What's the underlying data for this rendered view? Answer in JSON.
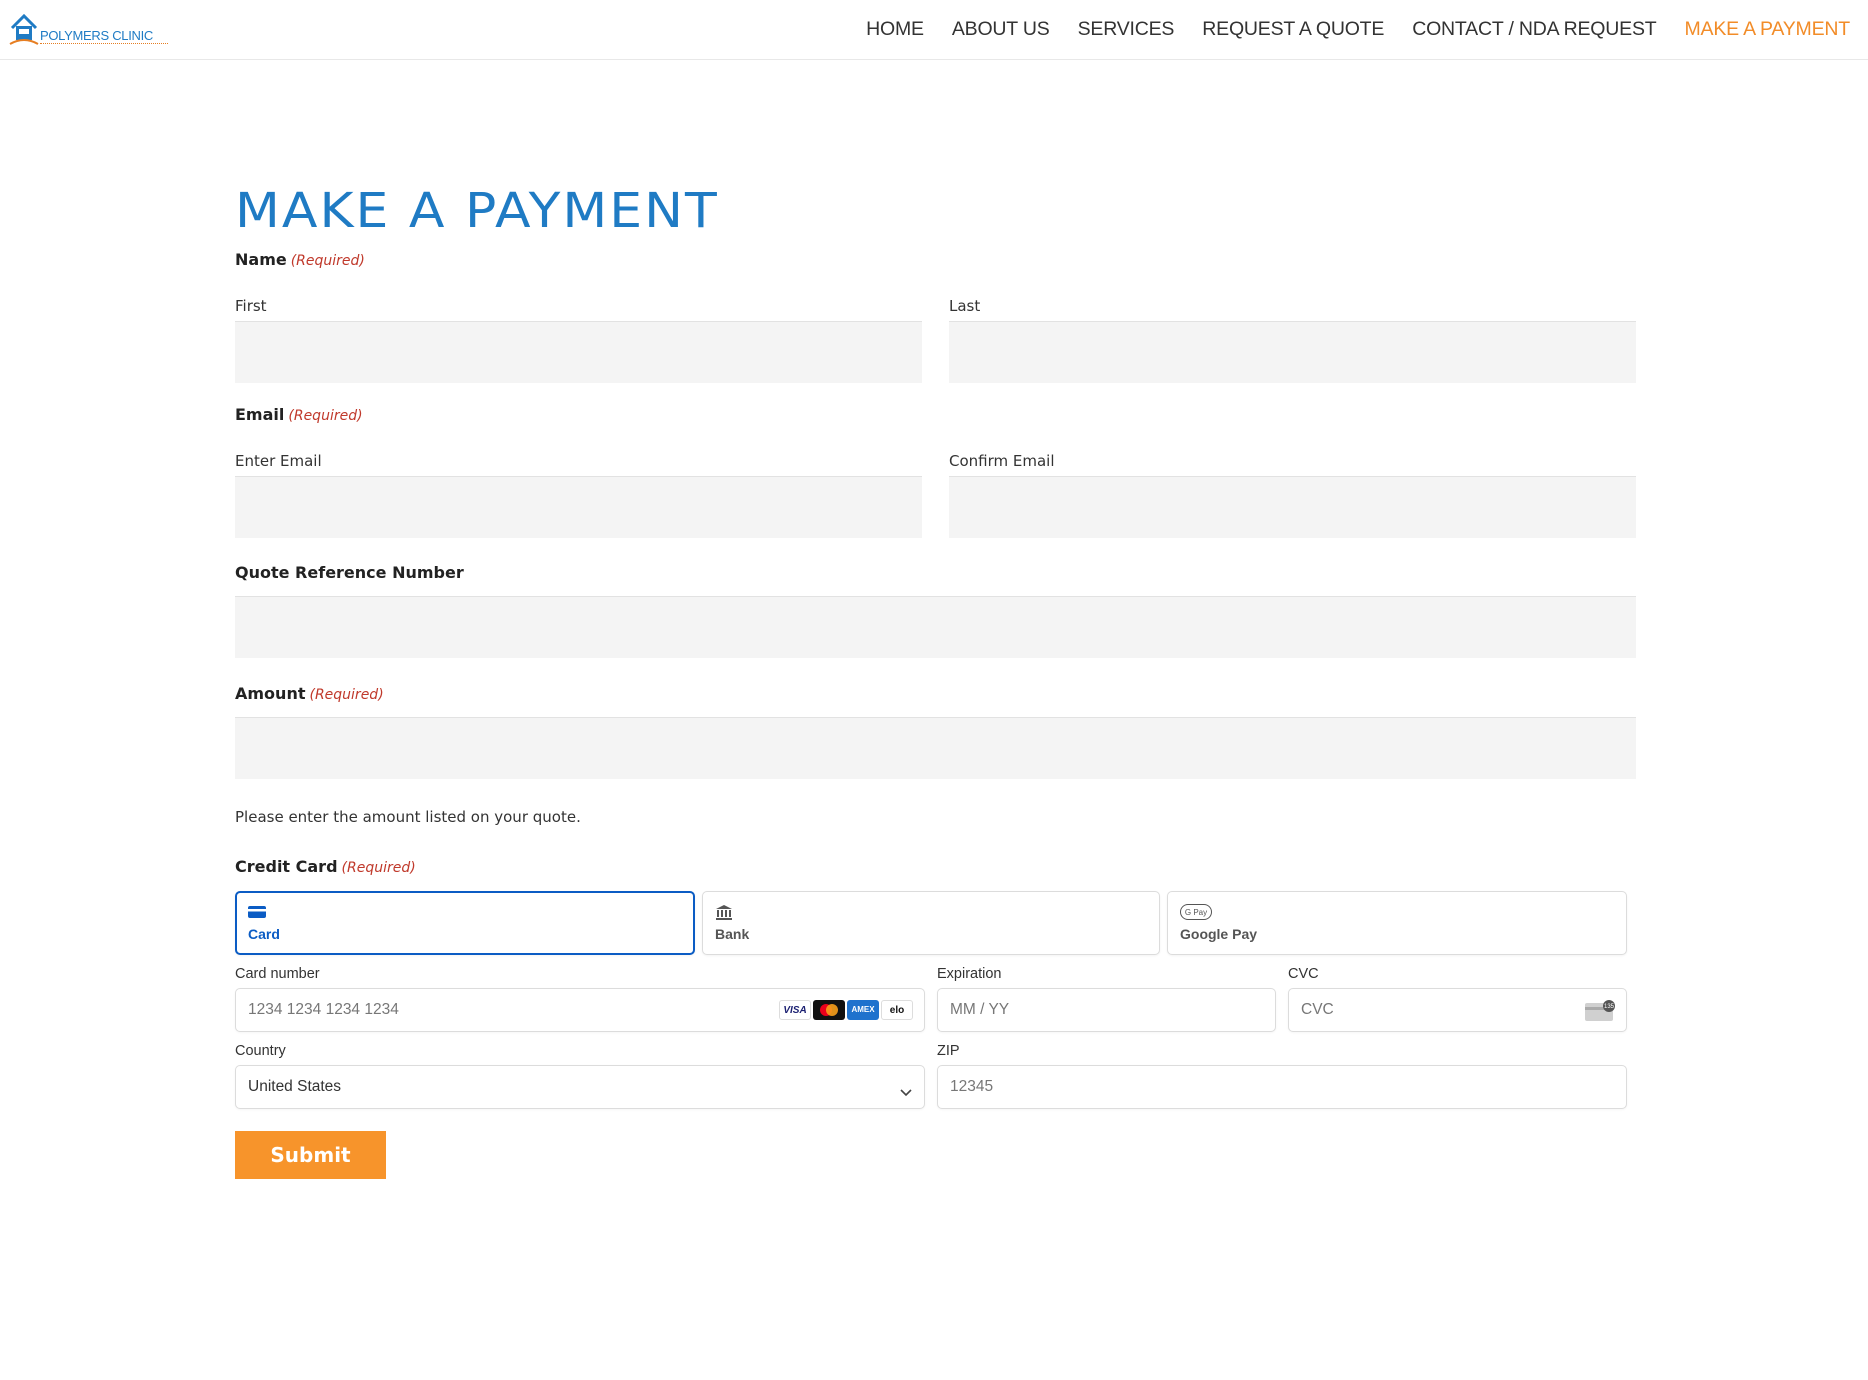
{
  "header": {
    "logo_text": "POLYMERS CLINIC",
    "nav": [
      {
        "label": "HOME"
      },
      {
        "label": "ABOUT US"
      },
      {
        "label": "SERVICES"
      },
      {
        "label": "REQUEST A QUOTE"
      },
      {
        "label": "CONTACT / NDA REQUEST"
      },
      {
        "label": "MAKE A PAYMENT"
      }
    ]
  },
  "page": {
    "title": "MAKE A PAYMENT"
  },
  "form": {
    "required_tag": "(Required)",
    "name": {
      "label": "Name",
      "first_label": "First",
      "last_label": "Last"
    },
    "email": {
      "label": "Email",
      "enter_label": "Enter Email",
      "confirm_label": "Confirm Email"
    },
    "quote_ref": {
      "label": "Quote Reference Number"
    },
    "amount": {
      "label": "Amount",
      "hint": "Please enter the amount listed on your quote."
    },
    "credit_card": {
      "label": "Credit Card"
    },
    "submit_label": "Submit"
  },
  "stripe": {
    "tabs": [
      {
        "label": "Card",
        "icon": "card-icon",
        "selected": true
      },
      {
        "label": "Bank",
        "icon": "bank-icon",
        "selected": false
      },
      {
        "label": "Google Pay",
        "icon": "google-pay-icon",
        "selected": false
      }
    ],
    "card_number": {
      "label": "Card number",
      "placeholder": "1234 1234 1234 1234"
    },
    "brands": [
      "VISA",
      "mastercard",
      "AMEX",
      "elo"
    ],
    "expiration": {
      "label": "Expiration",
      "placeholder": "MM / YY"
    },
    "cvc": {
      "label": "CVC",
      "placeholder": "CVC"
    },
    "country": {
      "label": "Country",
      "value": "United States"
    },
    "zip": {
      "label": "ZIP",
      "placeholder": "12345"
    }
  },
  "colors": {
    "brand_blue": "#1f7bc4",
    "accent_orange": "#f7942b",
    "stripe_blue": "#0b5cc4",
    "required_red": "#c0392b"
  }
}
